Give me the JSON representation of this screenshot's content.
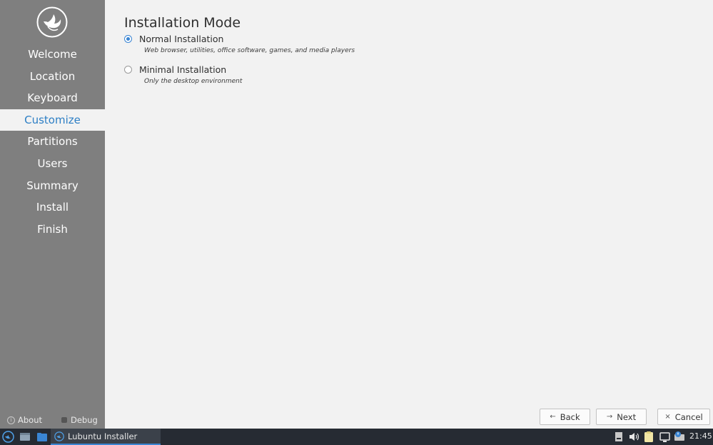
{
  "sidebar": {
    "logo_icon": "lubuntu-bird-logo-icon",
    "steps": [
      "Welcome",
      "Location",
      "Keyboard",
      "Customize",
      "Partitions",
      "Users",
      "Summary",
      "Install",
      "Finish"
    ],
    "active_step": "Customize",
    "about_label": "About",
    "debug_label": "Debug"
  },
  "main": {
    "title": "Installation Mode",
    "options": [
      {
        "label": "Normal Installation",
        "description": "Web browser, utilities, office software, games, and media players",
        "selected": true
      },
      {
        "label": "Minimal Installation",
        "description": "Only the desktop environment",
        "selected": false
      }
    ]
  },
  "buttons": {
    "back_label": "Back",
    "next_label": "Next",
    "cancel_label": "Cancel"
  },
  "taskbar": {
    "task_label": "Lubuntu Installer",
    "clock": "21:45"
  },
  "colors": {
    "accent": "#2d7fc5",
    "sidebar_bg": "#7f7f7f",
    "taskbar_bg": "#262b33"
  }
}
